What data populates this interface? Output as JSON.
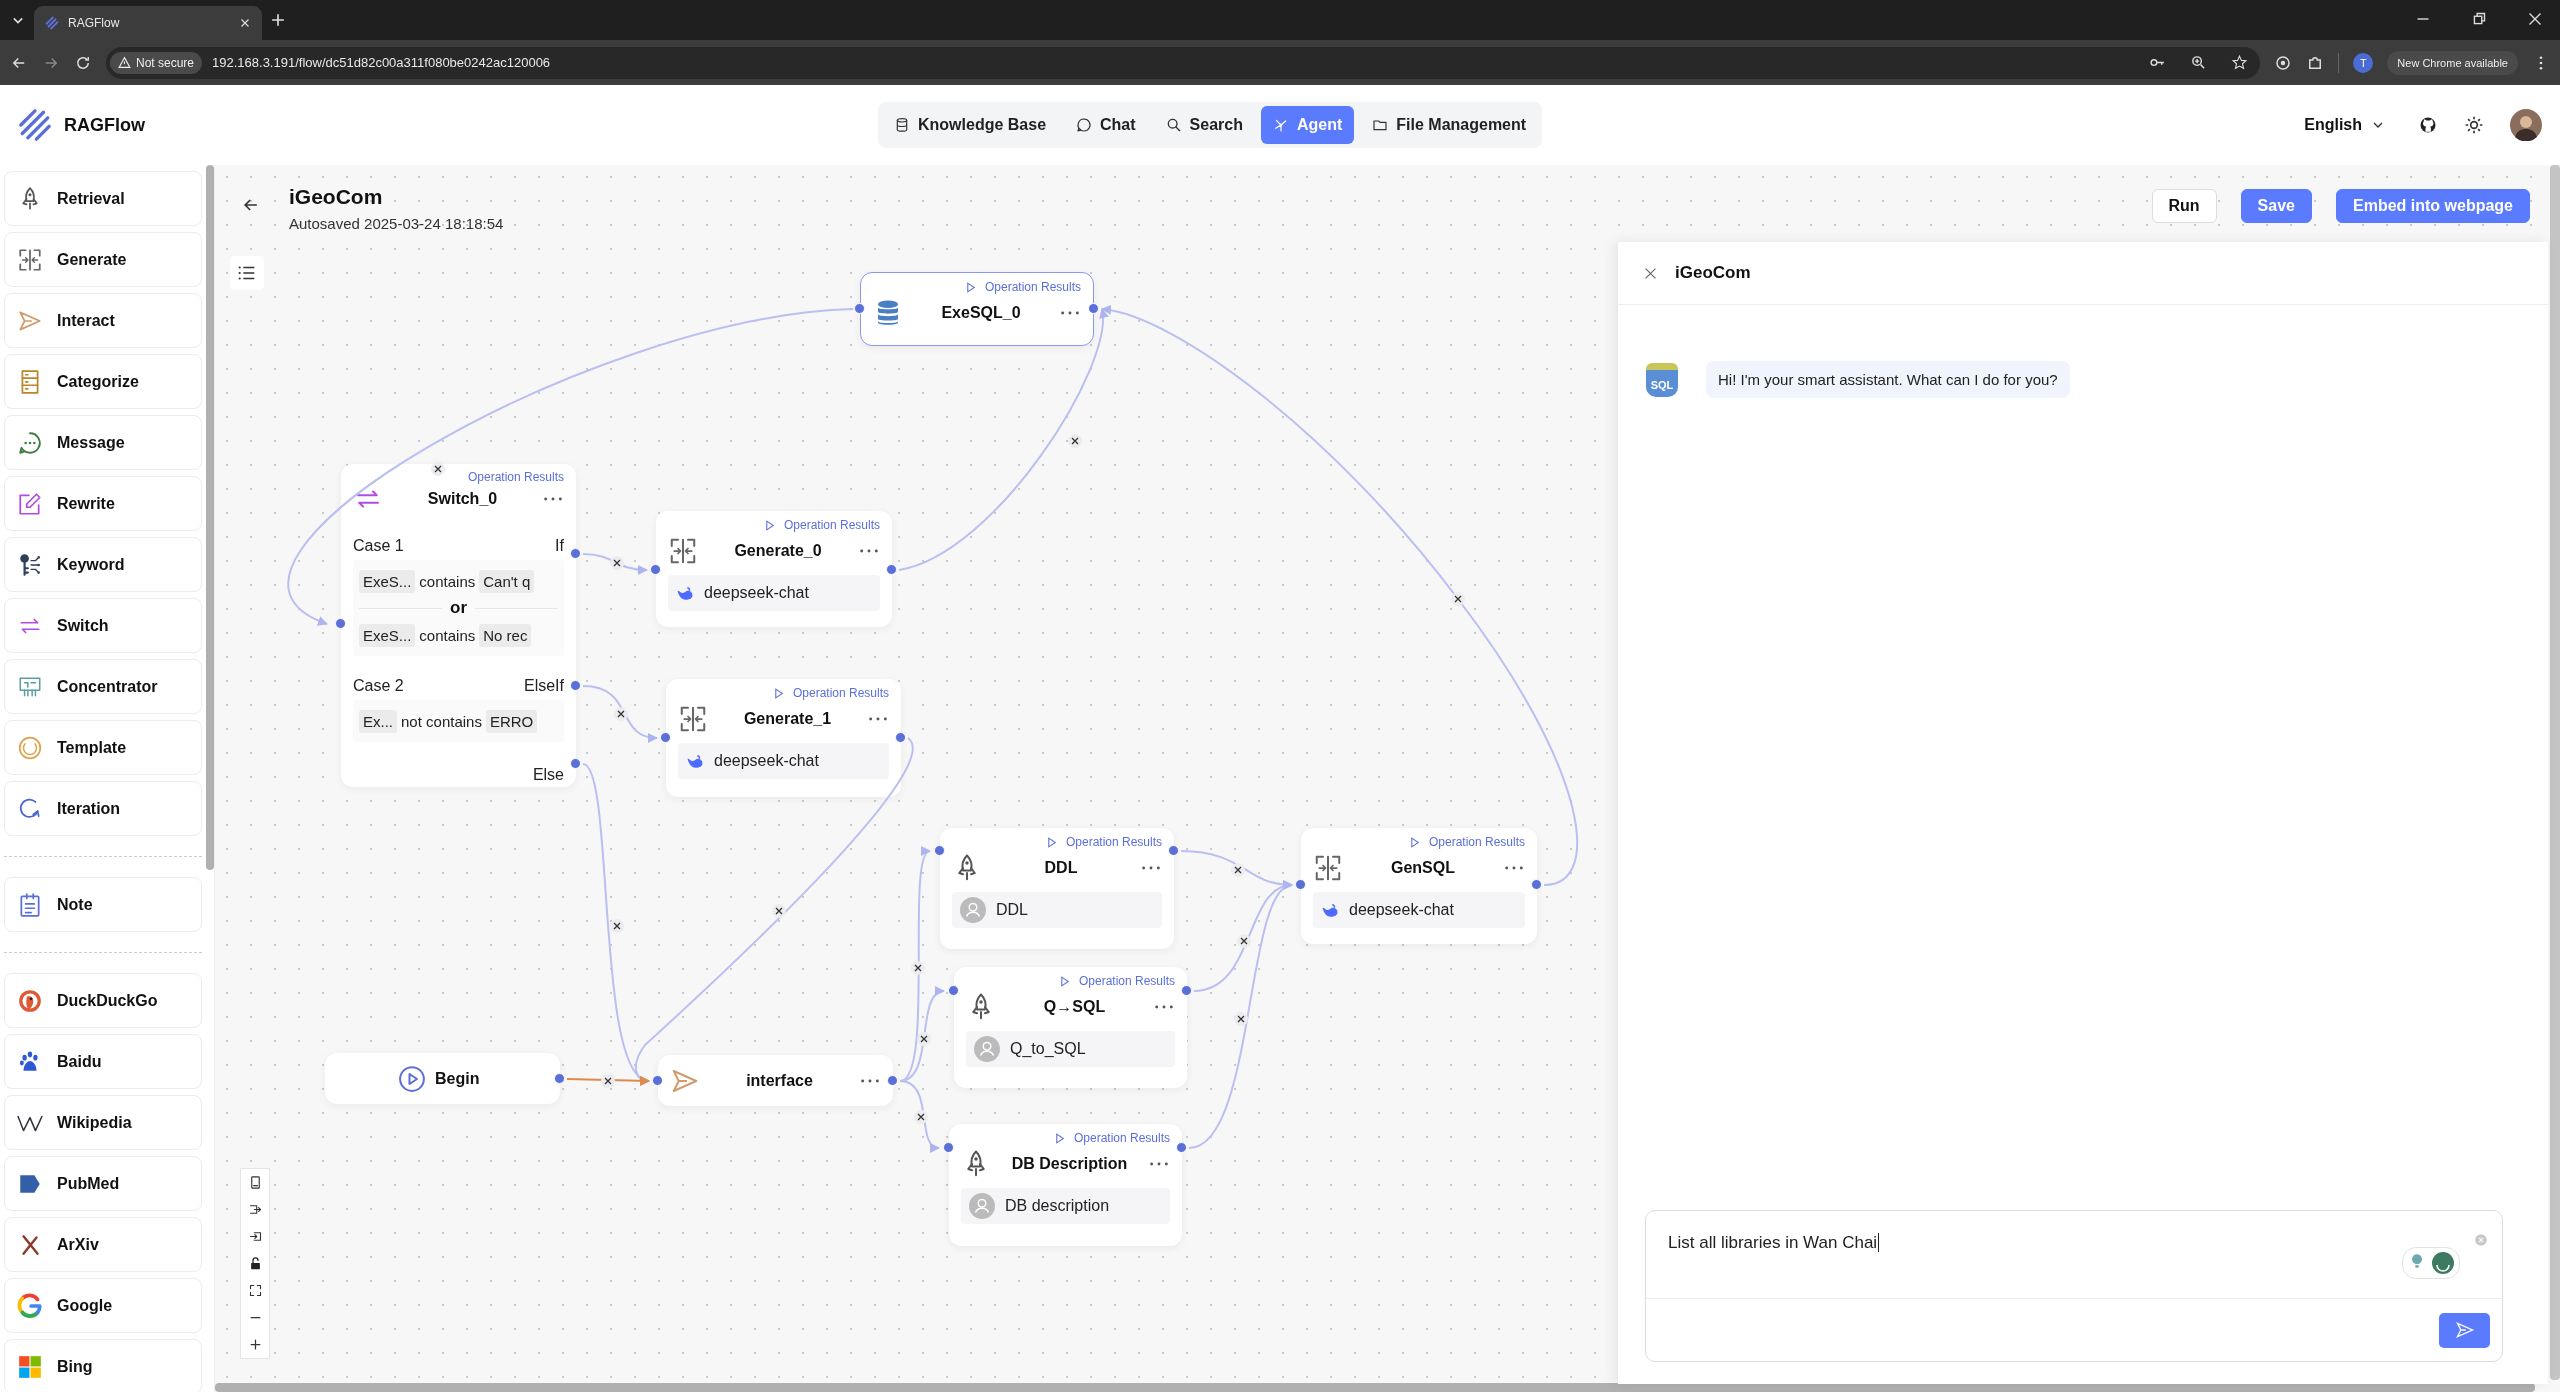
{
  "browser": {
    "tab_title": "RAGFlow",
    "warning": "Not secure",
    "url": "192.168.3.191/flow/dc51d82c00a311f080be0242ac120006",
    "profile": "T",
    "update_button": "New Chrome available"
  },
  "app": {
    "logo": "RAGFlow",
    "language": "English",
    "nav": [
      {
        "label": "Knowledge Base",
        "kind": "knowledge",
        "selected": false
      },
      {
        "label": "Chat",
        "kind": "chat",
        "selected": false
      },
      {
        "label": "Search",
        "kind": "search",
        "selected": false
      },
      {
        "label": "Agent",
        "kind": "agent",
        "selected": true
      },
      {
        "label": "File Management",
        "kind": "files",
        "selected": false
      }
    ]
  },
  "flow": {
    "title": "iGeoCom",
    "autosave": "Autosaved 2025-03-24 18:18:54",
    "buttons": [
      {
        "label": "Run",
        "kind": "plain"
      },
      {
        "label": "Save",
        "kind": "primary"
      },
      {
        "label": "Embed into webpage",
        "kind": "primary"
      }
    ]
  },
  "sidebar": {
    "groups": [
      [
        {
          "label": "Retrieval",
          "kind": "retrieval"
        },
        {
          "label": "Generate",
          "kind": "generate"
        },
        {
          "label": "Interact",
          "kind": "interact"
        },
        {
          "label": "Categorize",
          "kind": "categorize"
        },
        {
          "label": "Message",
          "kind": "message"
        },
        {
          "label": "Rewrite",
          "kind": "rewrite"
        },
        {
          "label": "Keyword",
          "kind": "keyword"
        },
        {
          "label": "Switch",
          "kind": "switch"
        },
        {
          "label": "Concentrator",
          "kind": "concentrator"
        },
        {
          "label": "Template",
          "kind": "template"
        },
        {
          "label": "Iteration",
          "kind": "iteration"
        }
      ],
      [
        {
          "label": "Note",
          "kind": "note"
        }
      ],
      [
        {
          "label": "DuckDuckGo",
          "kind": "duck"
        },
        {
          "label": "Baidu",
          "kind": "paw"
        },
        {
          "label": "Wikipedia",
          "kind": "zigzag"
        },
        {
          "label": "PubMed",
          "kind": "tag"
        },
        {
          "label": "ArXiv",
          "kind": "cross"
        },
        {
          "label": "Google",
          "kind": "ring"
        },
        {
          "label": "Bing",
          "kind": "squares"
        }
      ]
    ]
  },
  "nodes": [
    {
      "kind": "exesql",
      "title": "ExeSQL_0",
      "results": "Operation Results"
    },
    {
      "kind": "switch",
      "title": "Switch_0",
      "results": "Operation Results",
      "cases": [
        {
          "label": "Case 1",
          "port": "If",
          "joiner": "or",
          "conditions": [
            {
              "field": "ExeS...",
              "op": "contains",
              "value": "Can't q"
            },
            {
              "field": "ExeS...",
              "op": "contains",
              "value": "No rec"
            }
          ]
        },
        {
          "label": "Case 2",
          "port": "ElseIf",
          "conditions": [
            {
              "field": "Ex...",
              "op": "not contains",
              "value": "ERRO"
            }
          ]
        }
      ],
      "else_port": "Else"
    },
    {
      "kind": "generate",
      "title": "Generate_0",
      "results": "Operation Results",
      "model": "deepseek-chat"
    },
    {
      "kind": "generate",
      "title": "Generate_1",
      "results": "Operation Results",
      "model": "deepseek-chat"
    },
    {
      "kind": "retrieval",
      "title": "DDL",
      "results": "Operation Results",
      "source": "DDL"
    },
    {
      "kind": "generate",
      "title": "GenSQL",
      "results": "Operation Results",
      "model": "deepseek-chat"
    },
    {
      "kind": "retrieval",
      "title": "Q→SQL",
      "results": "Operation Results",
      "source": "Q_to_SQL"
    },
    {
      "kind": "begin",
      "title": "Begin"
    },
    {
      "kind": "interact",
      "title": "interface"
    },
    {
      "kind": "retrieval",
      "title": "DB Description",
      "results": "Operation Results",
      "source": "DB description"
    }
  ],
  "chat": {
    "title": "iGeoCom",
    "messages": [
      {
        "avatar": "SQL",
        "text": "Hi! I'm your smart assistant. What can I do for you?"
      }
    ],
    "input": {
      "value": "List all libraries in Wan Chai"
    }
  }
}
